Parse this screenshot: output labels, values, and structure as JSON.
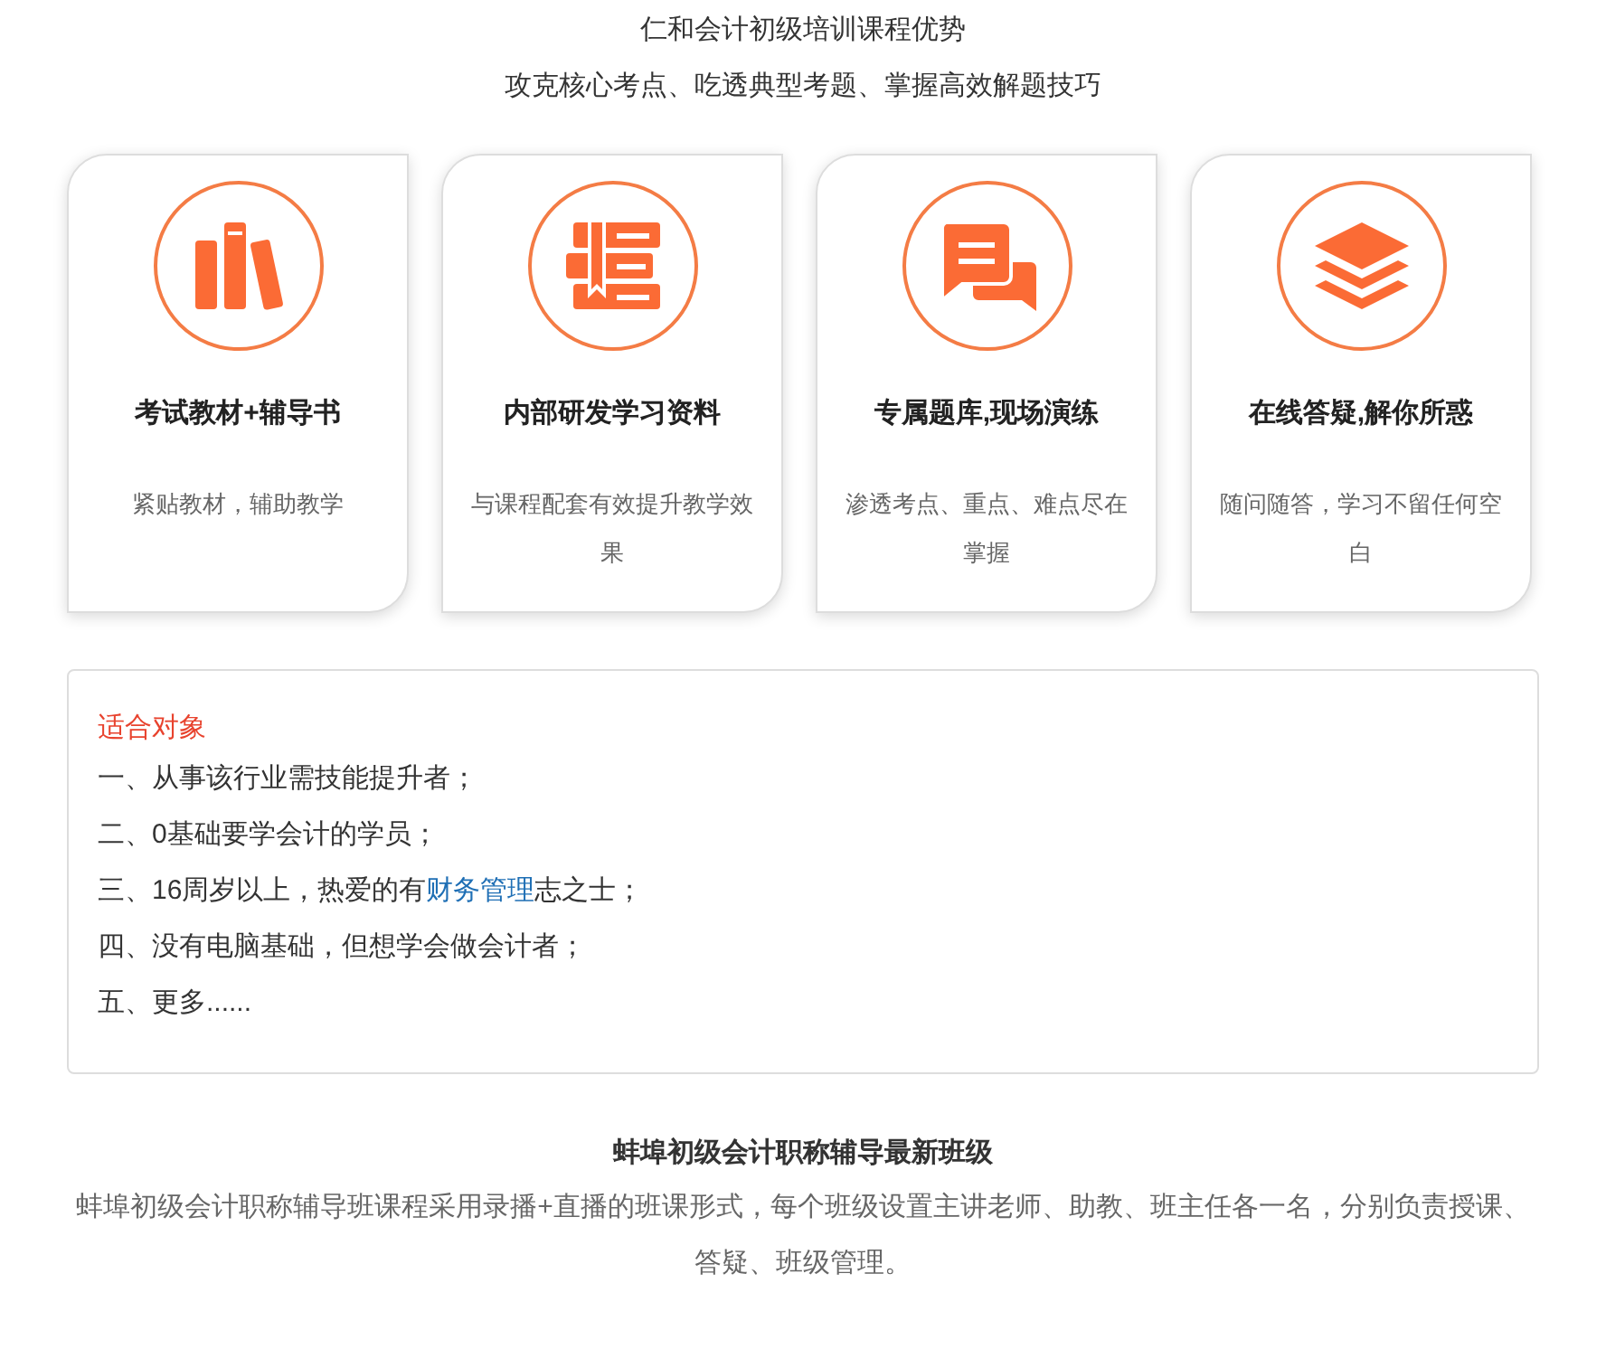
{
  "header": {
    "title": "仁和会计初级培训课程优势",
    "subtitle": "攻克核心考点、吃透典型考题、掌握高效解题技巧"
  },
  "cards": [
    {
      "title": "考试教材+辅导书",
      "description": "紧贴教材，辅助教学"
    },
    {
      "title": "内部研发学习资料",
      "description": "与课程配套有效提升教学效果"
    },
    {
      "title": "专属题库,现场演练",
      "description": "渗透考点、重点、难点尽在掌握"
    },
    {
      "title": "在线答疑,解你所惑",
      "description": "随问随答，学习不留任何空白"
    }
  ],
  "audience": {
    "heading": "适合对象",
    "items": [
      {
        "parts": [
          {
            "kind": "text",
            "text": "一、从事该行业需技能提升者；"
          }
        ]
      },
      {
        "parts": [
          {
            "kind": "text",
            "text": "二、0基础要学会计的学员；"
          }
        ]
      },
      {
        "parts": [
          {
            "kind": "text",
            "text": "三、16周岁以上，热爱的有"
          },
          {
            "kind": "link",
            "text": "财务管理"
          },
          {
            "kind": "text",
            "text": "志之士；"
          }
        ]
      },
      {
        "parts": [
          {
            "kind": "text",
            "text": "四、没有电脑基础，但想学会做会计者；"
          }
        ]
      },
      {
        "parts": [
          {
            "kind": "text",
            "text": "五、更多......"
          }
        ]
      }
    ]
  },
  "classes": {
    "heading": "蚌埠初级会计职称辅导最新班级",
    "text": "蚌埠初级会计职称辅导班课程采用录播+直播的班课形式，每个班级设置主讲老师、助教、班主任各一名，分别负责授课、答疑、班级管理。"
  }
}
